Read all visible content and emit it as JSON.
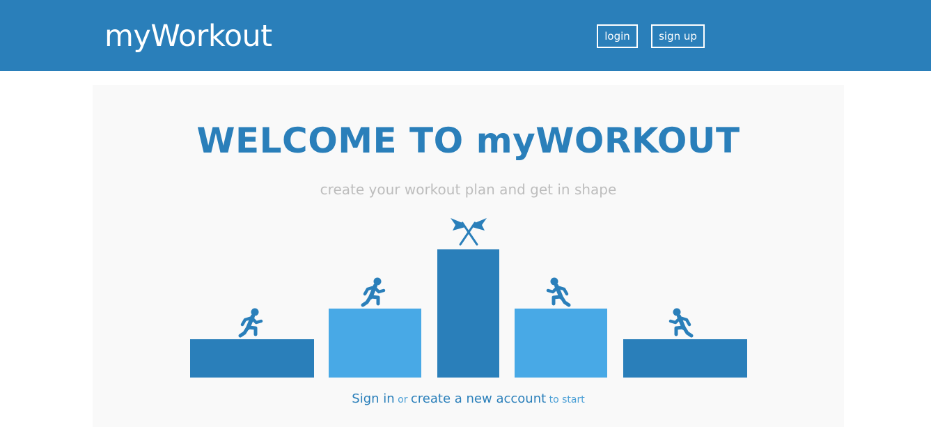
{
  "brand": {
    "name": "myWorkout"
  },
  "nav": {
    "login_label": "login",
    "signup_label": "sign up"
  },
  "hero": {
    "title": "WELCOME TO myWORKOUT",
    "subtitle": "create your workout plan and get in shape"
  },
  "cta": {
    "sign_in": "Sign in",
    "or": " or ",
    "create_account": "create a new account",
    "to_start": " to start"
  },
  "illustration": {
    "icons": [
      "runner-icon",
      "runner-icon",
      "crossed-flags-icon",
      "runner-icon",
      "runner-icon"
    ]
  },
  "colors": {
    "primary": "#2a7fba",
    "light_blue": "#48a9e6",
    "hero_bg": "#f9f9f9",
    "subtitle": "#bdbdbd"
  }
}
